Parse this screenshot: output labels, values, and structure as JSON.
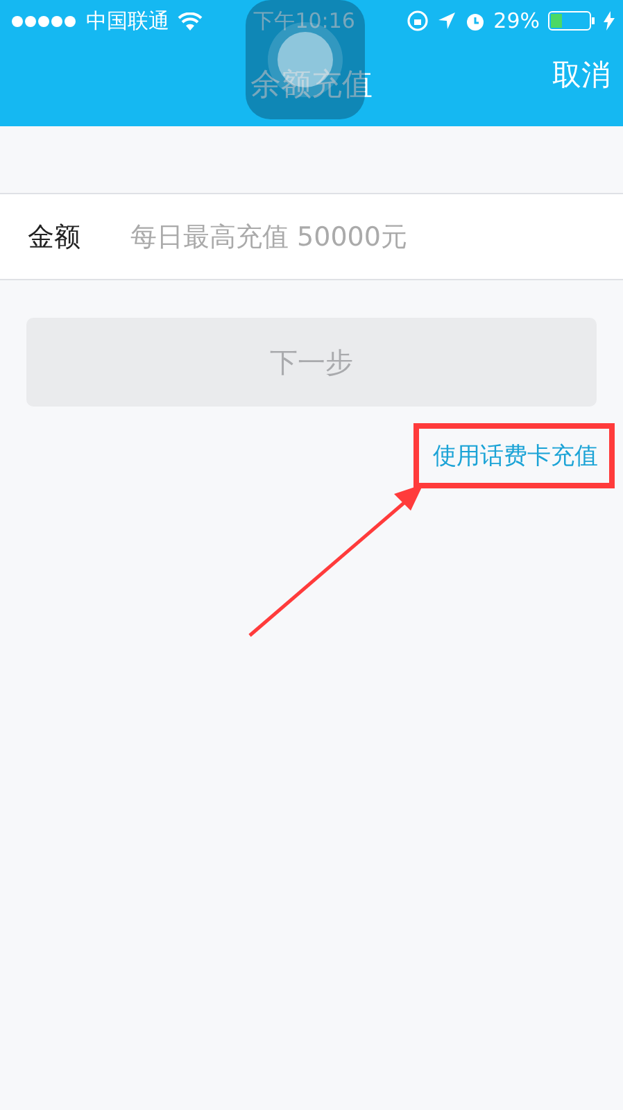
{
  "status_bar": {
    "carrier": "中国联通",
    "time": "下午10:16",
    "battery": "29%"
  },
  "nav": {
    "title": "余额充值",
    "cancel": "取消"
  },
  "amount": {
    "label": "金额",
    "placeholder": "每日最高充值 50000元"
  },
  "next_button": {
    "label": "下一步",
    "disabled": true
  },
  "card_link": {
    "label": "使用话费卡充值",
    "highlighted": true
  }
}
